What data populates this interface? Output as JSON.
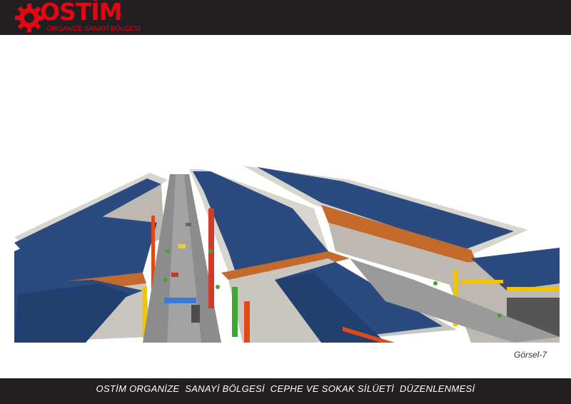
{
  "header": {
    "brand_name": "OSTİM",
    "brand_subtitle": "ORGANİZE SANAYİ BÖLGESİ",
    "brand_color": "#e30613",
    "bar_color": "#231f20"
  },
  "figure": {
    "caption": "Görsel-7",
    "roof_color": "#2b4a7f",
    "facade_color": "#c9c6c0",
    "accent_colors": [
      "#e04a1a",
      "#f2c500",
      "#3fa535"
    ]
  },
  "footer": {
    "title": "OSTİM ORGANİZE  SANAYİ BÖLGESİ  CEPHE VE SOKAK SİLÜETİ  DÜZENLENMESİ"
  }
}
